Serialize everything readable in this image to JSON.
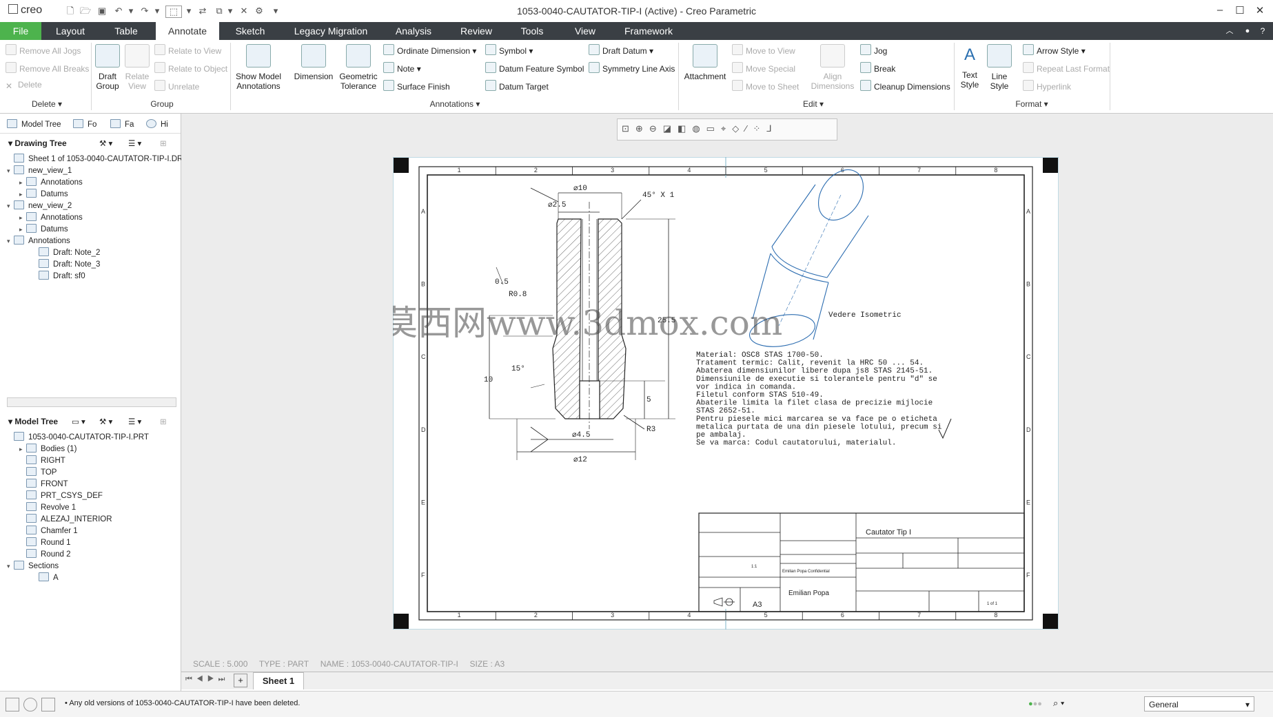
{
  "app": {
    "logo": "creo",
    "title": "1053-0040-CAUTATOR-TIP-I (Active) - Creo Parametric"
  },
  "tabs": [
    "File",
    "Layout",
    "Table",
    "Annotate",
    "Sketch",
    "Legacy Migration",
    "Analysis",
    "Review",
    "Tools",
    "View",
    "Framework"
  ],
  "ribbon": {
    "delete_group": {
      "items": [
        "Remove All Jogs",
        "Remove All Breaks",
        "Delete"
      ],
      "label": "Delete"
    },
    "group_group": {
      "draft_group": "Draft Group",
      "relate_view": "Relate View",
      "items": [
        "Relate to View",
        "Relate to Object",
        "Unrelate"
      ],
      "label": "Group"
    },
    "annotations_group": {
      "show_model": "Show Model Annotations",
      "dimension": "Dimension",
      "geom_tol": "Geometric Tolerance",
      "col1": [
        "Ordinate Dimension",
        "Note",
        "Surface Finish"
      ],
      "col2": [
        "Symbol",
        "Datum Feature Symbol",
        "Datum Target"
      ],
      "col3": [
        "Draft Datum",
        "Symmetry Line Axis"
      ],
      "label": "Annotations"
    },
    "edit_group": {
      "attachment": "Attachment",
      "col1": [
        "Move to View",
        "Move Special",
        "Move to Sheet"
      ],
      "align": "Align Dimensions",
      "col2": [
        "Jog",
        "Break",
        "Cleanup Dimensions"
      ],
      "label": "Edit"
    },
    "format_group": {
      "text_style": "Text Style",
      "line_style": "Line Style",
      "items": [
        "Arrow Style",
        "Repeat Last Format",
        "Hyperlink"
      ],
      "label": "Format"
    }
  },
  "leftpanel": {
    "tabs": [
      "Model Tree",
      "Fo",
      "Fa",
      "Hi"
    ],
    "drawing_tree_title": "Drawing Tree",
    "drawing_tree": [
      {
        "label": "Sheet 1 of 1053-0040-CAUTATOR-TIP-I.DRW",
        "level": 0,
        "arrow": ""
      },
      {
        "label": "new_view_1",
        "level": 0,
        "arrow": "▾"
      },
      {
        "label": "Annotations",
        "level": 1,
        "arrow": "▸"
      },
      {
        "label": "Datums",
        "level": 1,
        "arrow": "▸"
      },
      {
        "label": "new_view_2",
        "level": 0,
        "arrow": "▾"
      },
      {
        "label": "Annotations",
        "level": 1,
        "arrow": "▸"
      },
      {
        "label": "Datums",
        "level": 1,
        "arrow": "▸"
      },
      {
        "label": "Annotations",
        "level": 0,
        "arrow": "▾"
      },
      {
        "label": "Draft: Note_2",
        "level": 2,
        "arrow": ""
      },
      {
        "label": "Draft: Note_3",
        "level": 2,
        "arrow": ""
      },
      {
        "label": "Draft: sf0",
        "level": 2,
        "arrow": ""
      }
    ],
    "model_tree_title": "Model Tree",
    "model_tree": [
      {
        "label": "1053-0040-CAUTATOR-TIP-I.PRT",
        "level": 0,
        "arrow": ""
      },
      {
        "label": "Bodies (1)",
        "level": 1,
        "arrow": "▸"
      },
      {
        "label": "RIGHT",
        "level": 1,
        "arrow": ""
      },
      {
        "label": "TOP",
        "level": 1,
        "arrow": ""
      },
      {
        "label": "FRONT",
        "level": 1,
        "arrow": ""
      },
      {
        "label": "PRT_CSYS_DEF",
        "level": 1,
        "arrow": ""
      },
      {
        "label": "Revolve 1",
        "level": 1,
        "arrow": ""
      },
      {
        "label": "ALEZAJ_INTERIOR",
        "level": 1,
        "arrow": ""
      },
      {
        "label": "Chamfer 1",
        "level": 1,
        "arrow": ""
      },
      {
        "label": "Round 1",
        "level": 1,
        "arrow": ""
      },
      {
        "label": "Round 2",
        "level": 1,
        "arrow": ""
      },
      {
        "label": "Sections",
        "level": 0,
        "arrow": "▾"
      },
      {
        "label": "A",
        "level": 2,
        "arrow": ""
      }
    ]
  },
  "drawing": {
    "col_marks": [
      "1",
      "2",
      "3",
      "4",
      "5",
      "6",
      "7",
      "8"
    ],
    "row_marks": [
      "A",
      "B",
      "C",
      "D",
      "E",
      "F"
    ],
    "dims": {
      "d10": "⌀10",
      "d2_5": "⌀2.5",
      "chamfer": "45° X 1",
      "h25_5": "25.5",
      "d0_5": "0.5",
      "r0_8": "R0.8",
      "ang15": "15°",
      "h10": "10",
      "h5": "5",
      "r3": "R3",
      "d4_5": "⌀4.5",
      "d12": "⌀12"
    },
    "iso_label": "Vedere Isometric",
    "notes": [
      "Material: OSC8 STAS 1700-50.",
      "Tratament termic: Calit, revenit la HRC 50 ... 54.",
      "Abaterea dimensiunilor libere dupa js8 STAS 2145-51.",
      "Dimensiunile de executie si tolerantele pentru \"d\" se",
      "vor indica in comanda.",
      "Filetul conform STAS 510-49.",
      "Abaterile limita la filet clasa de precizie mijlocie",
      "STAS 2652-51.",
      "Pentru piesele mici marcarea se va face pe o eticheta",
      "metalica purtata de una din piesele lotului, precum si",
      "pe ambalaj.",
      "Se va marca: Codul cautatorului, materialul."
    ],
    "title_block": {
      "title": "Cautator Tip I",
      "size": "A3",
      "author": "Emilian Popa",
      "confidential": "Emilian Popa Confidential",
      "scale": "1:1",
      "sheet": "1 of 1"
    },
    "watermark": "莫西网www.3dmox.com"
  },
  "canvas_status": {
    "scale": "SCALE : 5.000",
    "type": "TYPE : PART",
    "name": "NAME : 1053-0040-CAUTATOR-TIP-I",
    "size": "SIZE : A3"
  },
  "sheet_tab": "Sheet 1",
  "statusbar": {
    "message": "Any old versions of 1053-0040-CAUTATOR-TIP-I have been deleted.",
    "filter": "General"
  }
}
